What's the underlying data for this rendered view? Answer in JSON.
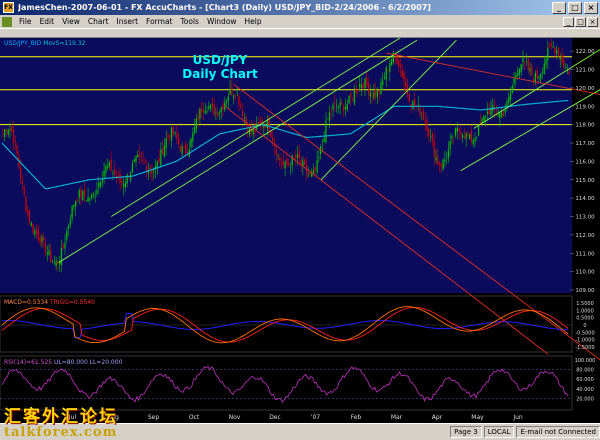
{
  "window": {
    "title": "JamesChen-2007-06-01 - FX AccuCharts - [Chart3 (Daily) USD/JPY_BID-2/24/2006 - 6/2/2007]",
    "app_badge": "FX"
  },
  "menu": [
    "File",
    "Edit",
    "View",
    "Chart",
    "Insert",
    "Format",
    "Tools",
    "Window",
    "Help"
  ],
  "chart": {
    "title_line1": "USD/JPY",
    "title_line2": "Daily Chart",
    "symbol_label": "USD/JPY_BID",
    "ma_label": "MovS=119.32",
    "macd_label": "MACD=0.5334",
    "trigger_label": "TRIGG=0.5540",
    "rsi_label": "RSI(14)=61.525",
    "rsi_levels_label": "UL=80.000  LL=20.000",
    "colors": {
      "background": "#000000",
      "main_panel": "#0b0b5e",
      "candle_up": "#00c000",
      "candle_down": "#d00000",
      "ma_line": "#00b0d0",
      "uptrend_lines": "#80ff40",
      "downtrend_lines": "#e03020",
      "horizontal_levels": "#ffff00",
      "macd_line": "#ff7000",
      "trigger_line": "#ff2020",
      "histogram": "#2020ff",
      "rsi_line": "#c030c0"
    },
    "price_axis": [
      "122.00",
      "121.00",
      "120.00",
      "119.00",
      "118.00",
      "117.00",
      "116.00",
      "115.00",
      "114.00",
      "113.00",
      "112.00",
      "111.00",
      "110.00",
      "109.00"
    ],
    "horizontal_levels": [
      121.7,
      119.9,
      118.0
    ],
    "macd_axis": [
      "1.5000",
      "1.0000",
      "0.5000",
      "0",
      "-0.5000",
      "-1.0000",
      "-1.5000"
    ],
    "rsi_axis": [
      "100.000",
      "80.000",
      "60.000",
      "40.000",
      "20.000"
    ],
    "time_axis": [
      "Jun",
      "Jul",
      "Aug",
      "Sep",
      "Oct",
      "Nov",
      "Dec",
      "'07",
      "Feb",
      "Mar",
      "Apr",
      "May",
      "Jun"
    ]
  },
  "chart_data": {
    "type": "line",
    "title": "USD/JPY Daily Chart",
    "xlabel": "",
    "ylabel": "",
    "x": [
      "May",
      "Jun",
      "Jul",
      "Aug",
      "Sep",
      "Oct",
      "Nov",
      "Dec",
      "Jan",
      "Feb",
      "Mar",
      "Apr",
      "May",
      "Jun"
    ],
    "series": [
      {
        "name": "USD/JPY_BID",
        "values": [
          117.5,
          110.5,
          115.0,
          115.0,
          117.5,
          119.0,
          117.8,
          115.5,
          119.5,
          121.5,
          116.0,
          118.5,
          120.5,
          121.8
        ]
      },
      {
        "name": "MovS",
        "values": [
          117.0,
          114.5,
          115.0,
          115.2,
          116.0,
          117.5,
          118.0,
          117.3,
          117.5,
          119.0,
          119.0,
          118.8,
          119.1,
          119.32
        ]
      }
    ],
    "ylim": [
      109.0,
      122.5
    ]
  },
  "status": {
    "watermark": "汇客外汇论坛",
    "site": "talkforex.com",
    "page": "Page 3",
    "mode": "LOCAL",
    "email": "E-mail not Connected"
  }
}
